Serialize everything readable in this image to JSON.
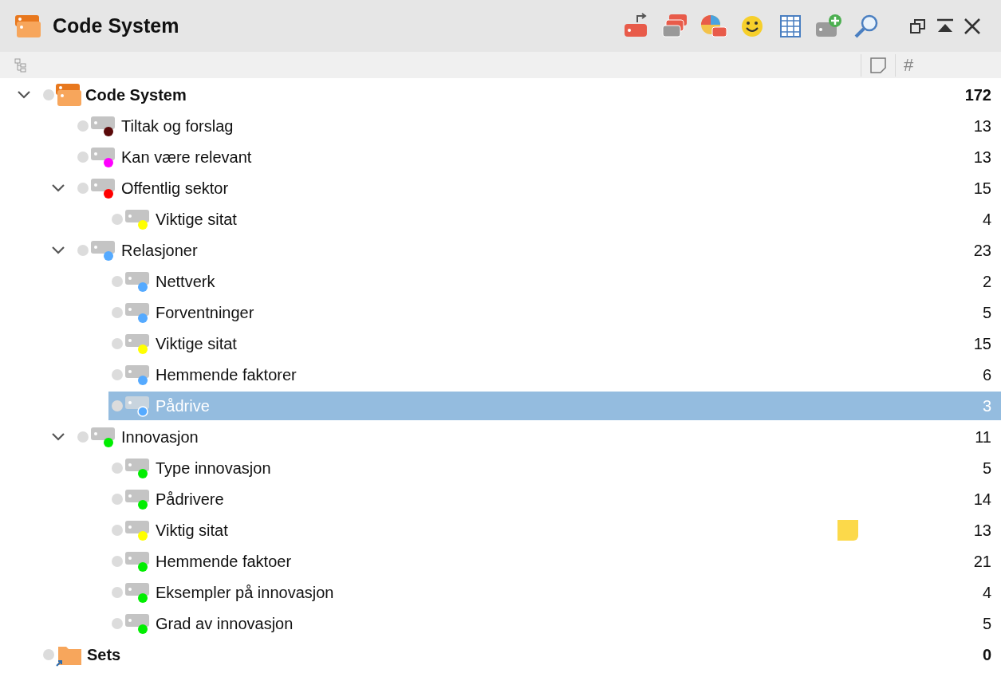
{
  "window": {
    "title": "Code System"
  },
  "columns": {
    "count_header": "#"
  },
  "tree": [
    {
      "kind": "root",
      "name": "Code System",
      "count": "172",
      "selected": false,
      "memo": false,
      "expanded": true,
      "children": [
        {
          "kind": "code",
          "name": "Tiltak og forslag",
          "count": "13",
          "color": "#5a0a0a",
          "selected": false,
          "memo": false
        },
        {
          "kind": "code",
          "name": "Kan være relevant",
          "count": "13",
          "color": "#ff00ff",
          "selected": false,
          "memo": false
        },
        {
          "kind": "code",
          "name": "Offentlig sektor",
          "count": "15",
          "color": "#ff0000",
          "selected": false,
          "memo": false,
          "expanded": true,
          "children": [
            {
              "kind": "code",
              "name": "Viktige sitat",
              "count": "4",
              "color": "#ffff00",
              "selected": false,
              "memo": false
            }
          ]
        },
        {
          "kind": "code",
          "name": "Relasjoner",
          "count": "23",
          "color": "#55aaff",
          "selected": false,
          "memo": false,
          "expanded": true,
          "children": [
            {
              "kind": "code",
              "name": "Nettverk",
              "count": "2",
              "color": "#55aaff",
              "selected": false,
              "memo": false
            },
            {
              "kind": "code",
              "name": "Forventninger",
              "count": "5",
              "color": "#55aaff",
              "selected": false,
              "memo": false
            },
            {
              "kind": "code",
              "name": "Viktige sitat",
              "count": "15",
              "color": "#ffff00",
              "selected": false,
              "memo": false
            },
            {
              "kind": "code",
              "name": "Hemmende faktorer",
              "count": "6",
              "color": "#55aaff",
              "selected": false,
              "memo": false
            },
            {
              "kind": "code",
              "name": "Pådrive",
              "count": "3",
              "color": "#55aaff",
              "selected": true,
              "memo": false
            }
          ]
        },
        {
          "kind": "code",
          "name": "Innovasjon",
          "count": "11",
          "color": "#00ee00",
          "selected": false,
          "memo": false,
          "expanded": true,
          "children": [
            {
              "kind": "code",
              "name": "Type innovasjon",
              "count": "5",
              "color": "#00ee00",
              "selected": false,
              "memo": false
            },
            {
              "kind": "code",
              "name": "Pådrivere",
              "count": "14",
              "color": "#00ee00",
              "selected": false,
              "memo": false
            },
            {
              "kind": "code",
              "name": "Viktig sitat",
              "count": "13",
              "color": "#ffff00",
              "selected": false,
              "memo": true
            },
            {
              "kind": "code",
              "name": "Hemmende faktoer",
              "count": "21",
              "color": "#00ee00",
              "selected": false,
              "memo": false
            },
            {
              "kind": "code",
              "name": "Eksempler på innovasjon",
              "count": "4",
              "color": "#00ee00",
              "selected": false,
              "memo": false
            },
            {
              "kind": "code",
              "name": "Grad av innovasjon",
              "count": "5",
              "color": "#00ee00",
              "selected": false,
              "memo": false
            }
          ]
        }
      ]
    },
    {
      "kind": "set",
      "name": "Sets",
      "count": "0",
      "selected": false,
      "memo": false
    }
  ]
}
